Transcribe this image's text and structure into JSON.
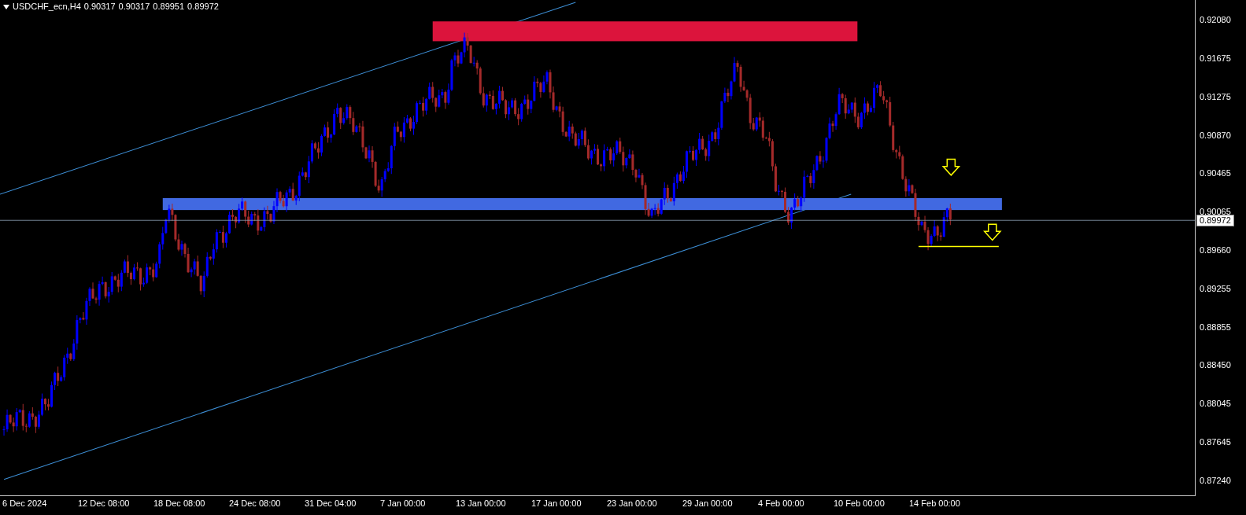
{
  "header": {
    "symbol": "USDCHF_ecn,H4",
    "values": [
      "0.90317",
      "0.90317",
      "0.89951",
      "0.89972"
    ]
  },
  "price_axis": {
    "labels": [
      "0.92080",
      "0.91675",
      "0.91275",
      "0.90870",
      "0.90465",
      "0.90065",
      "0.89660",
      "0.89255",
      "0.88855",
      "0.88450",
      "0.88045",
      "0.87645",
      "0.87240"
    ],
    "current_price": "0.89972"
  },
  "time_axis": {
    "labels": [
      "6 Dec 2024",
      "12 Dec 08:00",
      "18 Dec 08:00",
      "24 Dec 08:00",
      "31 Dec 04:00",
      "7 Jan 00:00",
      "13 Jan 00:00",
      "17 Jan 00:00",
      "23 Jan 00:00",
      "29 Jan 00:00",
      "4 Feb 00:00",
      "10 Feb 00:00",
      "14 Feb 00:00"
    ]
  }
}
